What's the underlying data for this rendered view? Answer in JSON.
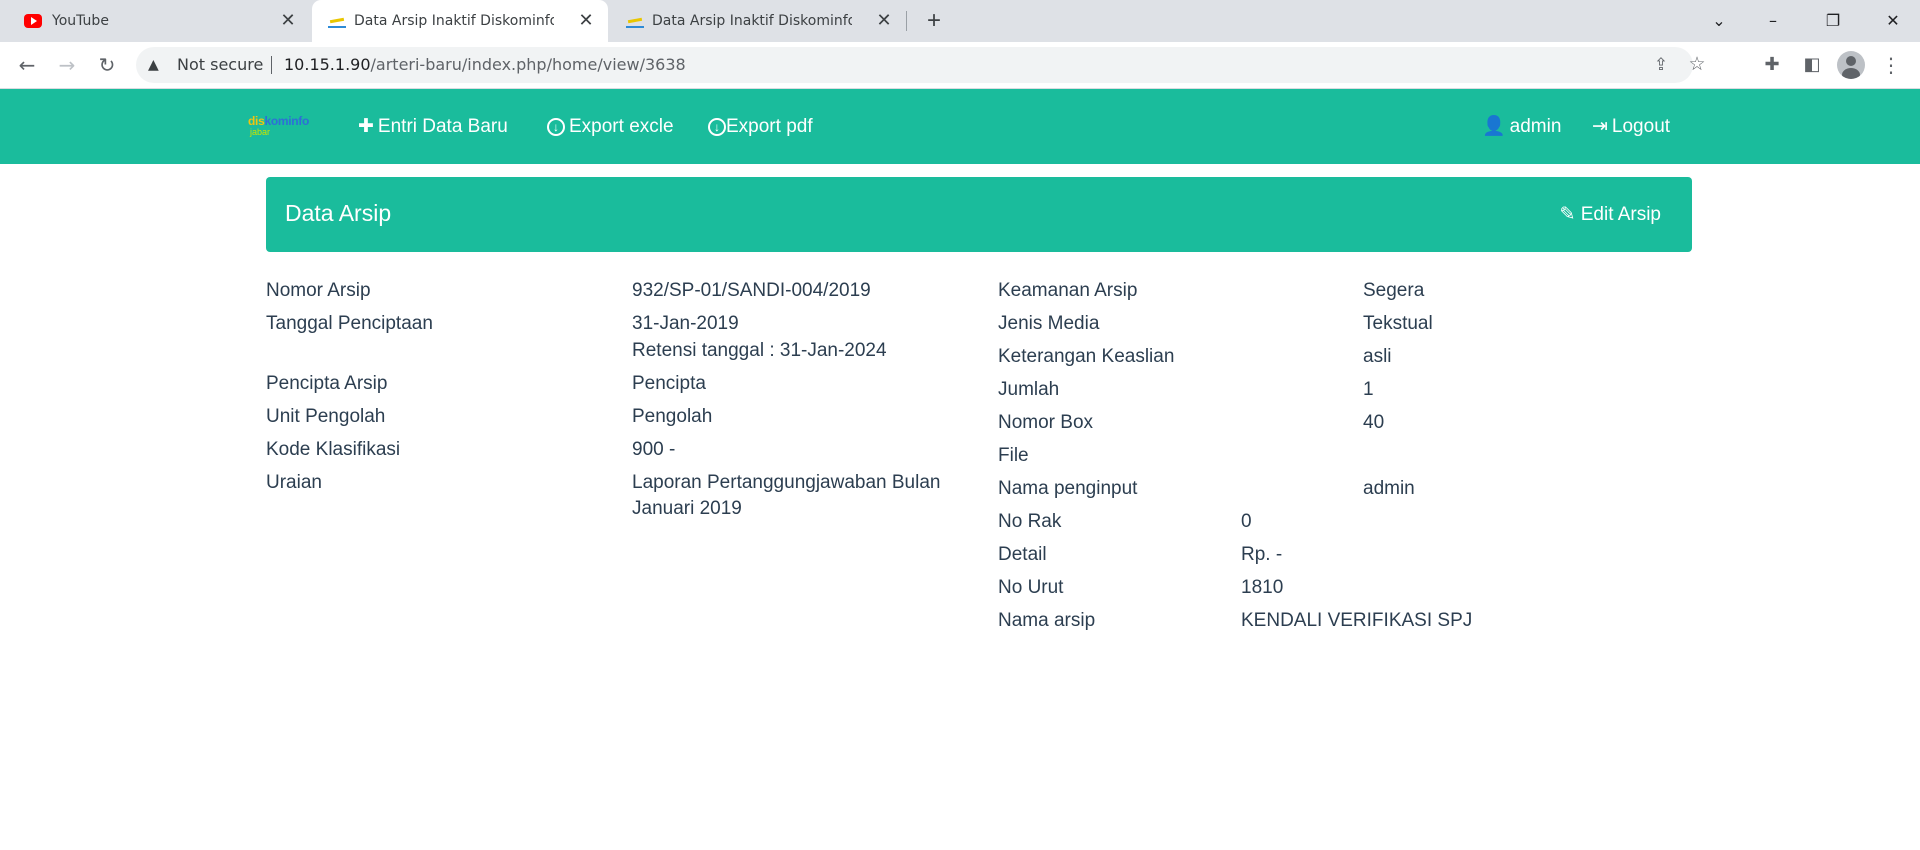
{
  "browser": {
    "tabs": [
      {
        "title": "YouTube",
        "active": false,
        "favicon": "youtube-icon"
      },
      {
        "title": "Data Arsip Inaktif Diskominfo Jaw",
        "active": true,
        "favicon": "diskominfo-icon"
      },
      {
        "title": "Data Arsip Inaktif Diskominfo Jaw",
        "active": false,
        "favicon": "diskominfo-icon"
      }
    ],
    "security_label": "Not secure",
    "url_host": "10.15.1.90",
    "url_path": "/arteri-baru/index.php/home/view/3638"
  },
  "navbar": {
    "brand_line1_a": "dis",
    "brand_line1_b": "kominfo",
    "brand_line2": "jabar",
    "links": {
      "entri": "Entri Data Baru",
      "excel": "Export excle",
      "pdf": "Export pdf",
      "user": "admin",
      "logout": "Logout"
    }
  },
  "panel": {
    "title": "Data Arsip",
    "edit_label": "Edit Arsip"
  },
  "left_fields": [
    {
      "label": "Nomor Arsip",
      "value": "932/SP-01/SANDI-004/2019"
    },
    {
      "label": "Tanggal Penciptaan",
      "value": "31-Jan-2019",
      "extra": "Retensi tanggal : 31-Jan-2024"
    },
    {
      "label": "Pencipta Arsip",
      "value": "Pencipta"
    },
    {
      "label": "Unit Pengolah",
      "value": "Pengolah"
    },
    {
      "label": "Kode Klasifikasi",
      "value": "900 -"
    },
    {
      "label": "Uraian",
      "value": "Laporan Pertanggungjawaban Bulan Januari 2019"
    }
  ],
  "right_fields": [
    {
      "label": "Keamanan Arsip",
      "value": "Segera"
    },
    {
      "label": "Jenis Media",
      "value": "Tekstual"
    },
    {
      "label": "Keterangan Keaslian",
      "value": "asli"
    },
    {
      "label": "Jumlah",
      "value": "1"
    },
    {
      "label": "Nomor Box",
      "value": "40"
    },
    {
      "label": "File",
      "value": ""
    },
    {
      "label": "Nama penginput",
      "value": "admin"
    },
    {
      "label": "No Rak",
      "value": "0"
    },
    {
      "label": "Detail",
      "value": "Rp. -"
    },
    {
      "label": "No Urut",
      "value": "1810"
    },
    {
      "label": "Nama arsip",
      "value": "KENDALI VERIFIKASI SPJ"
    }
  ],
  "colors": {
    "accent": "#1abc9c",
    "text": "#2c3e50"
  }
}
